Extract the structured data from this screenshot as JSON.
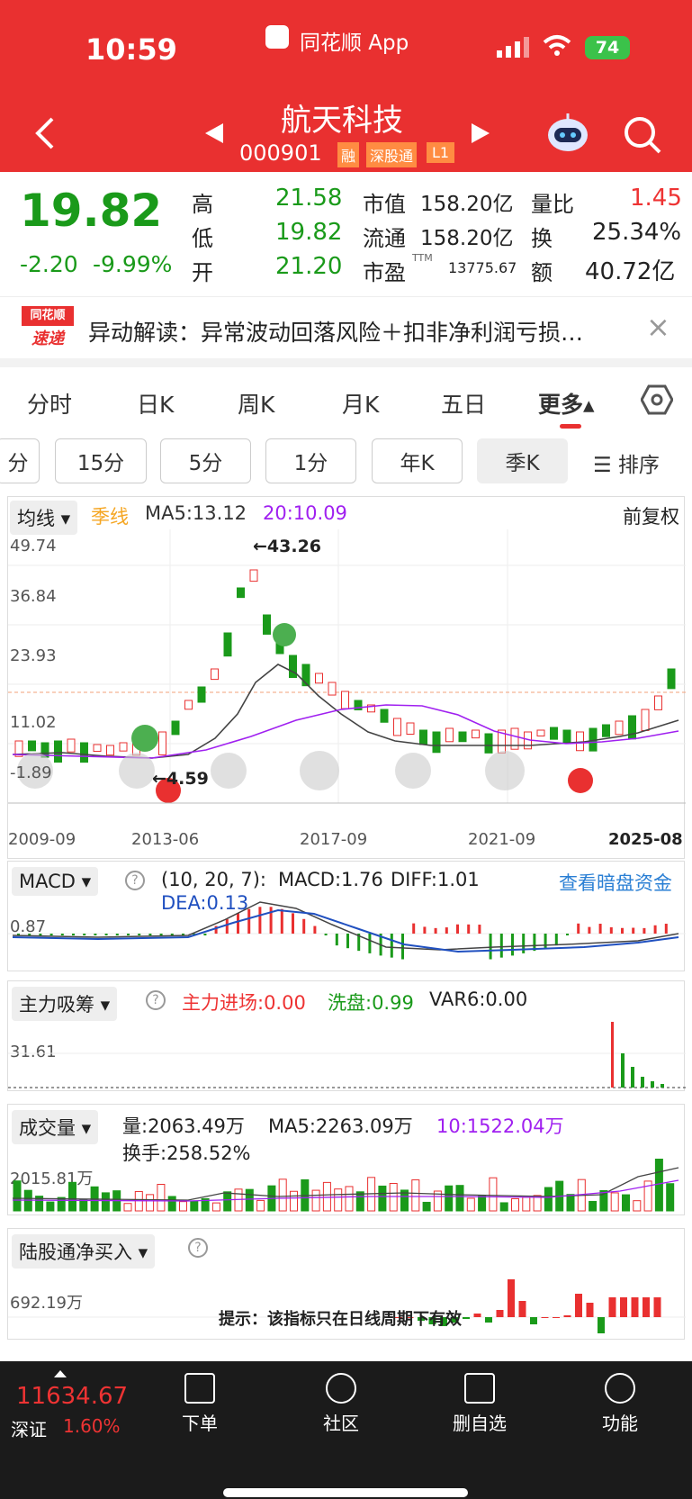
{
  "status_bar": {
    "time": "10:59",
    "source_app": "同花顺 App",
    "battery": "74"
  },
  "header": {
    "title": "航天科技",
    "code": "000901",
    "badges": [
      "融",
      "深股通",
      "L1"
    ]
  },
  "quote": {
    "price": "19.82",
    "change": "-2.20",
    "change_pct": "-9.99%",
    "high_label": "高",
    "high": "21.58",
    "low_label": "低",
    "low": "19.82",
    "open_label": "开",
    "open": "21.20",
    "mktcap_label": "市值",
    "mktcap": "158.20亿",
    "float_label": "流通",
    "float": "158.20亿",
    "pe_label": "市盈",
    "pe_sup": "TTM",
    "pe": "13775.67",
    "vr_label": "量比",
    "vr": "1.45",
    "turn_label": "换",
    "turn": "25.34%",
    "amt_label": "额",
    "amt": "40.72亿"
  },
  "notice": {
    "logo_top": "同花顺",
    "logo_bottom": "速递",
    "text": "异动解读：异常波动回落风险＋扣非净利润亏损…",
    "close": "×"
  },
  "tabs": [
    "分时",
    "日K",
    "周K",
    "月K",
    "五日",
    "更多▴"
  ],
  "periods": [
    "分",
    "15分",
    "5分",
    "1分",
    "年K",
    "季K",
    "☰ 排序"
  ],
  "kline": {
    "ma_label": "均线",
    "season": "季线",
    "ma5": "MA5:13.12",
    "ma20": "20:10.09",
    "adj": "前复权",
    "y_ticks": [
      "49.74",
      "36.84",
      "23.93",
      "11.02",
      "-1.89"
    ],
    "x_ticks": [
      "2009-09",
      "2013-06",
      "2017-09",
      "2021-09",
      "2025-08"
    ],
    "max_label": "←43.26",
    "min_label": "←4.59"
  },
  "macd": {
    "name": "MACD",
    "params": "(10, 20, 7):",
    "macd": "MACD:1.76",
    "diff": "DIFF:1.01",
    "dea": "DEA:0.13",
    "link": "查看暗盘资金",
    "tick": "0.87"
  },
  "zlxc": {
    "name": "主力吸筹",
    "jc": "主力进场:0.00",
    "xp": "洗盘:0.99",
    "var6": "VAR6:0.00",
    "tick": "31.61"
  },
  "vol": {
    "name": "成交量",
    "vol": "量:2063.49万",
    "ma5": "MA5:2263.09万",
    "ma10": "10:1522.04万",
    "turn": "换手:258.52%",
    "tick": "2015.81万"
  },
  "lgt": {
    "name": "陆股通净买入",
    "tick": "692.19万",
    "hint": "提示：该指标只在日线周期下有效"
  },
  "bottom": {
    "index_value": "11634.67",
    "index_name": "深证",
    "index_pct": "1.60%",
    "items": [
      "下单",
      "社区",
      "删自选",
      "功能"
    ]
  },
  "colors": {
    "red": "#e93030",
    "green": "#1a9a1a",
    "purple": "#a020f0",
    "blue": "#2050c0"
  }
}
